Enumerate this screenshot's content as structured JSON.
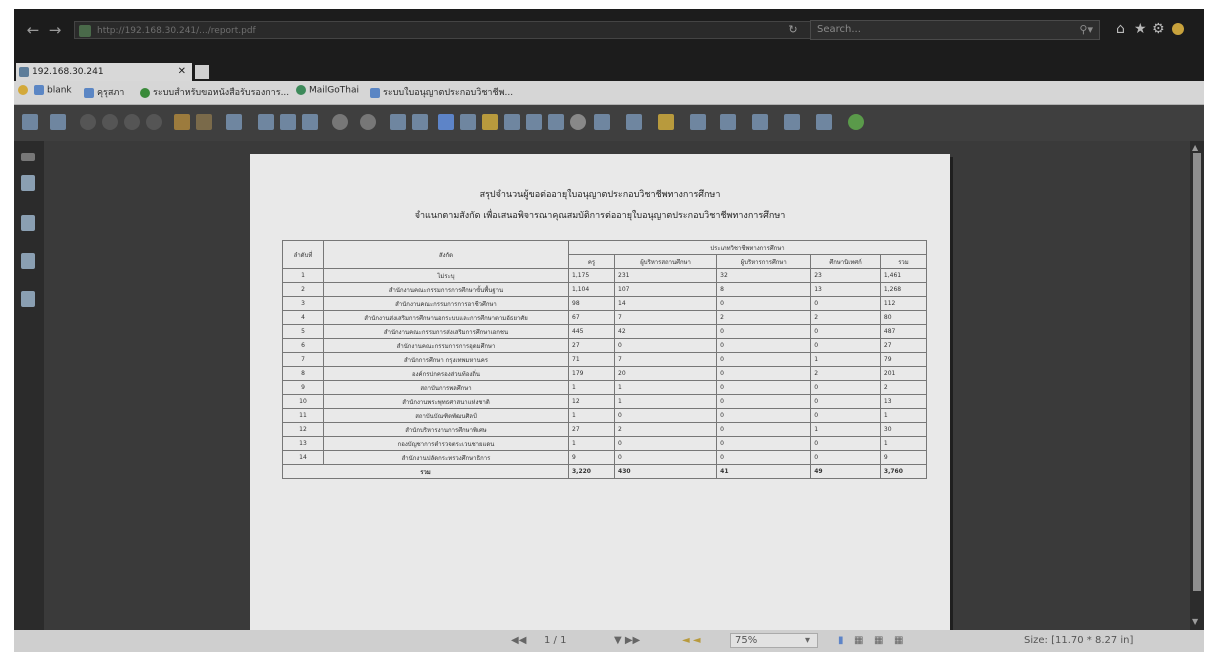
{
  "browser": {
    "url": "http://192.168.30.241/.../report.pdf",
    "search_placeholder": "Search...",
    "search_icon": "search-icon",
    "tab_title": "192.168.30.241",
    "favorites": [
      {
        "label": "blank"
      },
      {
        "label": "คุรุสภา"
      },
      {
        "label": "ระบบสำหรับขอหนังสือรับรองการ..."
      },
      {
        "label": "MailGoThai"
      },
      {
        "label": "ระบบใบอนุญาตประกอบวิชาชีพ..."
      }
    ]
  },
  "document": {
    "title_line1": "สรุปจำนวนผู้ขอต่ออายุใบอนุญาตประกอบวิชาชีพทางการศึกษา",
    "title_line2": "จำแนกตามสังกัด เพื่อเสนอพิจารณาคุณสมบัติการต่ออายุใบอนุญาตประกอบวิชาชีพทางการศึกษา",
    "table": {
      "col_no": "ลำดับที่",
      "col_affiliation": "สังกัด",
      "group_header": "ประเภทวิชาชีพทางการศึกษา",
      "col_teacher": "ครู",
      "col_admin_school": "ผู้บริหารสถานศึกษา",
      "col_admin_edu": "ผู้บริหารการศึกษา",
      "col_supervisor": "ศึกษานิเทศก์",
      "col_total": "รวม",
      "rows": [
        {
          "no": "1",
          "name": "ไม่ระบุ",
          "teacher": "1,175",
          "admin_school": "231",
          "admin_edu": "32",
          "supervisor": "23",
          "total": "1,461"
        },
        {
          "no": "2",
          "name": "สำนักงานคณะกรรมการการศึกษาขั้นพื้นฐาน",
          "teacher": "1,104",
          "admin_school": "107",
          "admin_edu": "8",
          "supervisor": "13",
          "total": "1,268"
        },
        {
          "no": "3",
          "name": "สำนักงานคณะกรรมการการอาชีวศึกษา",
          "teacher": "98",
          "admin_school": "14",
          "admin_edu": "0",
          "supervisor": "0",
          "total": "112"
        },
        {
          "no": "4",
          "name": "สำนักงานส่งเสริมการศึกษานอกระบบและการศึกษาตามอัธยาศัย",
          "teacher": "67",
          "admin_school": "7",
          "admin_edu": "2",
          "supervisor": "2",
          "total": "80"
        },
        {
          "no": "5",
          "name": "สำนักงานคณะกรรมการส่งเสริมการศึกษาเอกชน",
          "teacher": "445",
          "admin_school": "42",
          "admin_edu": "0",
          "supervisor": "0",
          "total": "487"
        },
        {
          "no": "6",
          "name": "สำนักงานคณะกรรมการการอุดมศึกษา",
          "teacher": "27",
          "admin_school": "0",
          "admin_edu": "0",
          "supervisor": "0",
          "total": "27"
        },
        {
          "no": "7",
          "name": "สำนักการศึกษา กรุงเทพมหานคร",
          "teacher": "71",
          "admin_school": "7",
          "admin_edu": "0",
          "supervisor": "1",
          "total": "79"
        },
        {
          "no": "8",
          "name": "องค์กรปกครองส่วนท้องถิ่น",
          "teacher": "179",
          "admin_school": "20",
          "admin_edu": "0",
          "supervisor": "2",
          "total": "201"
        },
        {
          "no": "9",
          "name": "สถาบันการพลศึกษา",
          "teacher": "1",
          "admin_school": "1",
          "admin_edu": "0",
          "supervisor": "0",
          "total": "2"
        },
        {
          "no": "10",
          "name": "สำนักงานพระพุทธศาสนาแห่งชาติ",
          "teacher": "12",
          "admin_school": "1",
          "admin_edu": "0",
          "supervisor": "0",
          "total": "13"
        },
        {
          "no": "11",
          "name": "สถาบันบัณฑิตพัฒนศิลป์",
          "teacher": "1",
          "admin_school": "0",
          "admin_edu": "0",
          "supervisor": "0",
          "total": "1"
        },
        {
          "no": "12",
          "name": "สำนักบริหารงานการศึกษาพิเศษ",
          "teacher": "27",
          "admin_school": "2",
          "admin_edu": "0",
          "supervisor": "1",
          "total": "30"
        },
        {
          "no": "13",
          "name": "กองบัญชาการตำรวจตระเวนชายแดน",
          "teacher": "1",
          "admin_school": "0",
          "admin_edu": "0",
          "supervisor": "0",
          "total": "1"
        },
        {
          "no": "14",
          "name": "สำนักงานปลัดกระทรวงศึกษาธิการ",
          "teacher": "9",
          "admin_school": "0",
          "admin_edu": "0",
          "supervisor": "0",
          "total": "9"
        }
      ],
      "total_label": "รวม",
      "total_teacher": "3,220",
      "total_admin_school": "430",
      "total_admin_edu": "41",
      "total_supervisor": "49",
      "total_all": "3,760"
    }
  },
  "statusbar": {
    "page_indicator": "1 / 1",
    "zoom": "75%",
    "size": "Size: [11.70 * 8.27 in]"
  }
}
